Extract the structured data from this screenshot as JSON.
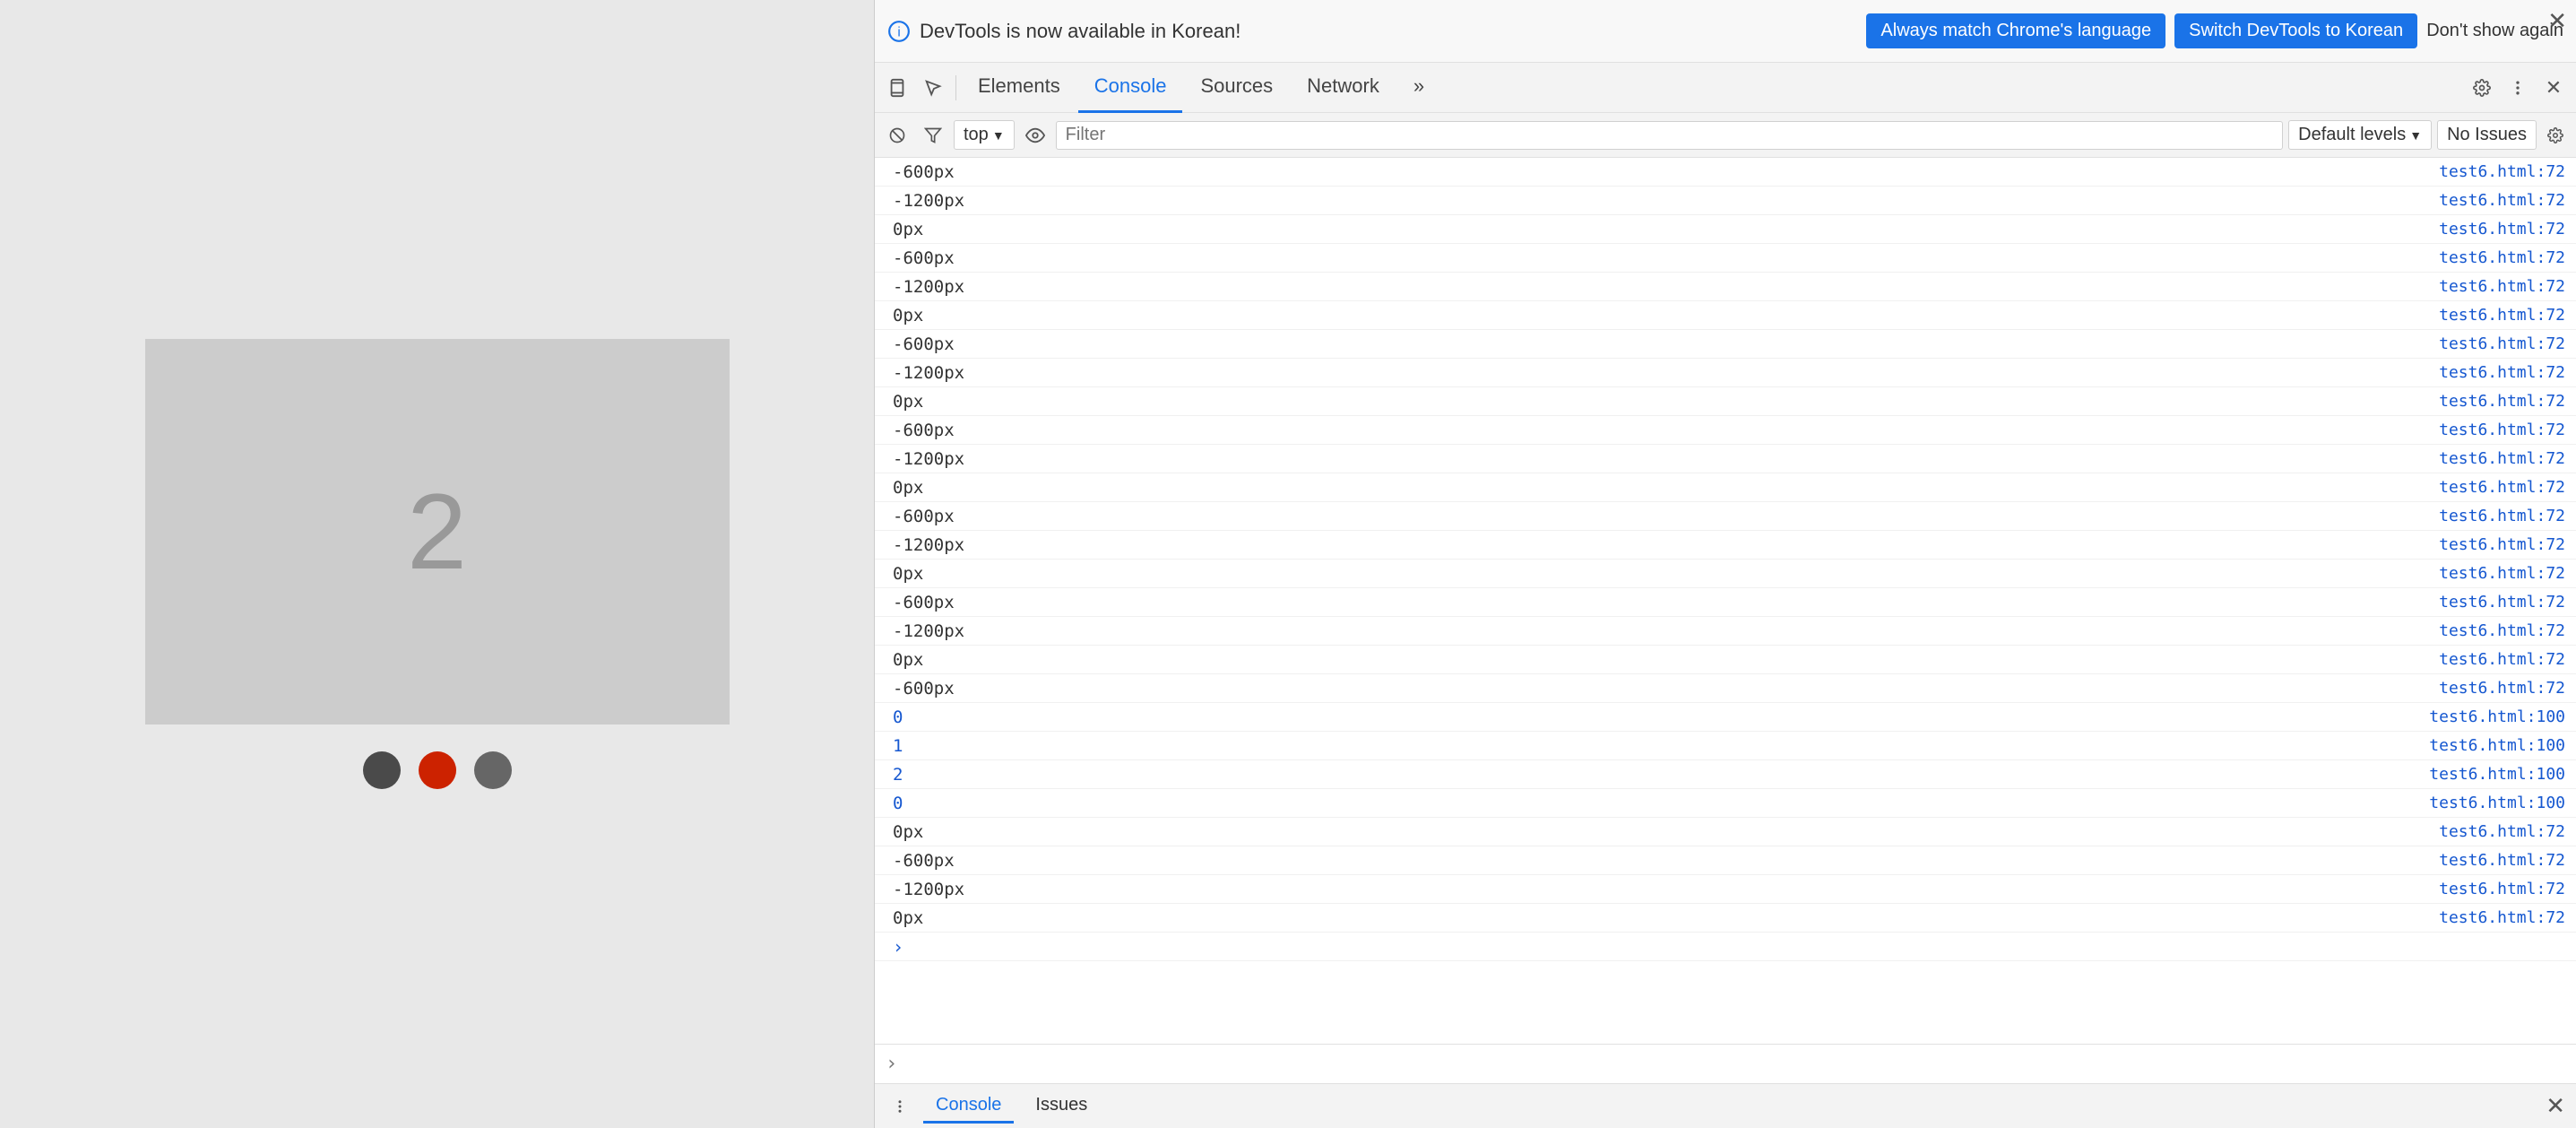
{
  "webpage": {
    "slide_number": "2",
    "dots": [
      {
        "color": "dark",
        "label": "dot-1"
      },
      {
        "color": "red",
        "label": "dot-2-active"
      },
      {
        "color": "gray",
        "label": "dot-3"
      }
    ]
  },
  "devtools": {
    "notification": {
      "text": "DevTools is now available in Korean!",
      "btn_always_match": "Always match Chrome's language",
      "btn_switch": "Switch DevTools to Korean",
      "btn_dont_show": "Don't show again"
    },
    "tabs": [
      {
        "label": "Elements",
        "active": false
      },
      {
        "label": "Console",
        "active": true
      },
      {
        "label": "Sources",
        "active": false
      },
      {
        "label": "Network",
        "active": false
      },
      {
        "label": "»",
        "active": false
      }
    ],
    "console_toolbar": {
      "top_label": "top",
      "filter_placeholder": "Filter",
      "default_levels": "Default levels",
      "no_issues": "No Issues"
    },
    "log_entries": [
      {
        "value": "-600px",
        "source": "test6.html:72",
        "type": "normal"
      },
      {
        "value": "-1200px",
        "source": "test6.html:72",
        "type": "normal"
      },
      {
        "value": "0px",
        "source": "test6.html:72",
        "type": "normal"
      },
      {
        "value": "-600px",
        "source": "test6.html:72",
        "type": "normal"
      },
      {
        "value": "-1200px",
        "source": "test6.html:72",
        "type": "normal"
      },
      {
        "value": "0px",
        "source": "test6.html:72",
        "type": "normal"
      },
      {
        "value": "-600px",
        "source": "test6.html:72",
        "type": "normal"
      },
      {
        "value": "-1200px",
        "source": "test6.html:72",
        "type": "normal"
      },
      {
        "value": "0px",
        "source": "test6.html:72",
        "type": "normal"
      },
      {
        "value": "-600px",
        "source": "test6.html:72",
        "type": "normal"
      },
      {
        "value": "-1200px",
        "source": "test6.html:72",
        "type": "normal"
      },
      {
        "value": "0px",
        "source": "test6.html:72",
        "type": "normal"
      },
      {
        "value": "-600px",
        "source": "test6.html:72",
        "type": "normal"
      },
      {
        "value": "-1200px",
        "source": "test6.html:72",
        "type": "normal"
      },
      {
        "value": "0px",
        "source": "test6.html:72",
        "type": "normal"
      },
      {
        "value": "-600px",
        "source": "test6.html:72",
        "type": "normal"
      },
      {
        "value": "-1200px",
        "source": "test6.html:72",
        "type": "normal"
      },
      {
        "value": "0px",
        "source": "test6.html:72",
        "type": "normal"
      },
      {
        "value": "-600px",
        "source": "test6.html:72",
        "type": "normal"
      },
      {
        "value": "0",
        "source": "test6.html:100",
        "type": "blue"
      },
      {
        "value": "1",
        "source": "test6.html:100",
        "type": "blue"
      },
      {
        "value": "2",
        "source": "test6.html:100",
        "type": "blue"
      },
      {
        "value": "0",
        "source": "test6.html:100",
        "type": "blue"
      },
      {
        "value": "0px",
        "source": "test6.html:72",
        "type": "normal"
      },
      {
        "value": "-600px",
        "source": "test6.html:72",
        "type": "normal"
      },
      {
        "value": "-1200px",
        "source": "test6.html:72",
        "type": "normal"
      },
      {
        "value": "0px",
        "source": "test6.html:72",
        "type": "normal"
      }
    ],
    "footer": {
      "console_tab": "Console",
      "issues_tab": "Issues",
      "chevron_icon": "›"
    }
  },
  "colors": {
    "active_tab": "#1a73e8",
    "btn_primary": "#1a73e8",
    "blue_text": "#1557d0",
    "dot_red": "#cc2200",
    "dot_dark": "#4a4a4a",
    "dot_gray": "#666666"
  }
}
